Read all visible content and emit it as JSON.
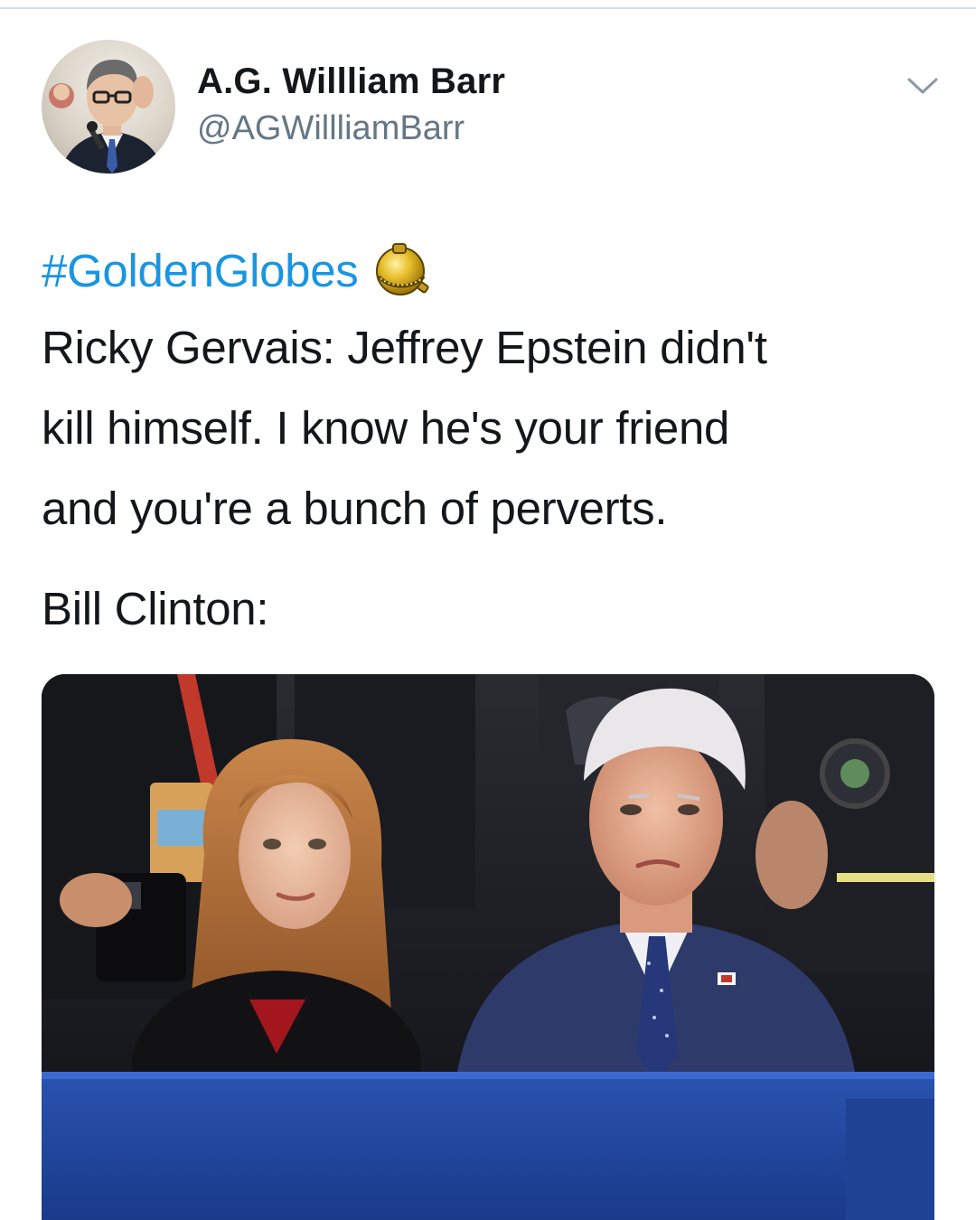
{
  "tweet": {
    "author": {
      "display_name": "A.G. Willliam Barr",
      "handle": "@AGWillliamBarr",
      "avatar_icon": "profile-photo"
    },
    "menu_icon": "chevron-down-icon",
    "hashtag": "#GoldenGlobes",
    "hashtag_emoji": "golden-globe-icon",
    "text_lines": [
      "Ricky Gervais: Jeffrey Epstein didn't",
      "kill himself. I know he's your friend",
      "and you're a bunch of perverts."
    ],
    "reply_line": "Bill Clinton:",
    "media": {
      "type": "photo"
    }
  },
  "colors": {
    "link": "#1b95e0",
    "text": "#14171a",
    "secondary": "#657786",
    "divider": "#d7dde3"
  }
}
